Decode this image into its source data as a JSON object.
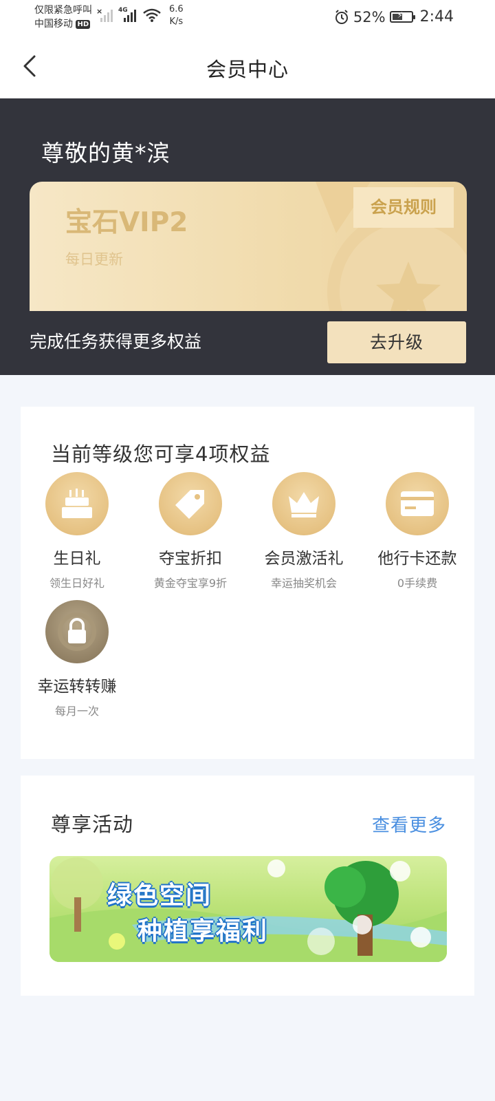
{
  "status_bar": {
    "carrier_line1": "仅限紧急呼叫",
    "carrier_line2": "中国移动",
    "hd_badge": "HD",
    "network": "4G",
    "speed_value": "6.6",
    "speed_unit": "K/s",
    "battery": "52%",
    "battery_level": 0.52,
    "time": "2:44"
  },
  "header": {
    "title": "会员中心",
    "back_icon": "chevron-left-icon"
  },
  "member": {
    "greeting": "尊敬的黄*滨",
    "level": "宝石VIP2",
    "update_note": "每日更新",
    "rules_label": "会员规则",
    "task_text": "完成任务获得更多权益",
    "upgrade_label": "去升级"
  },
  "benefits": {
    "title": "当前等级您可享4项权益",
    "items": [
      {
        "name": "生日礼",
        "desc": "领生日好礼",
        "icon": "birthday-cake-icon"
      },
      {
        "name": "夺宝折扣",
        "desc": "黄金夺宝享9折",
        "icon": "price-tag-icon"
      },
      {
        "name": "会员激活礼",
        "desc": "幸运抽奖机会",
        "icon": "crown-icon"
      },
      {
        "name": "他行卡还款",
        "desc": "0手续费",
        "icon": "bank-card-icon"
      },
      {
        "name": "幸运转转赚",
        "desc": "每月一次",
        "icon": "lock-icon"
      }
    ]
  },
  "activity": {
    "title": "尊享活动",
    "more_label": "查看更多",
    "banner": {
      "line1": "绿色空间",
      "line2": "种植享福利"
    }
  },
  "colors": {
    "dark_bg": "#33343c",
    "gold": "#d9b877",
    "link_blue": "#4a8fe0",
    "page_bg": "#f3f6fb"
  }
}
